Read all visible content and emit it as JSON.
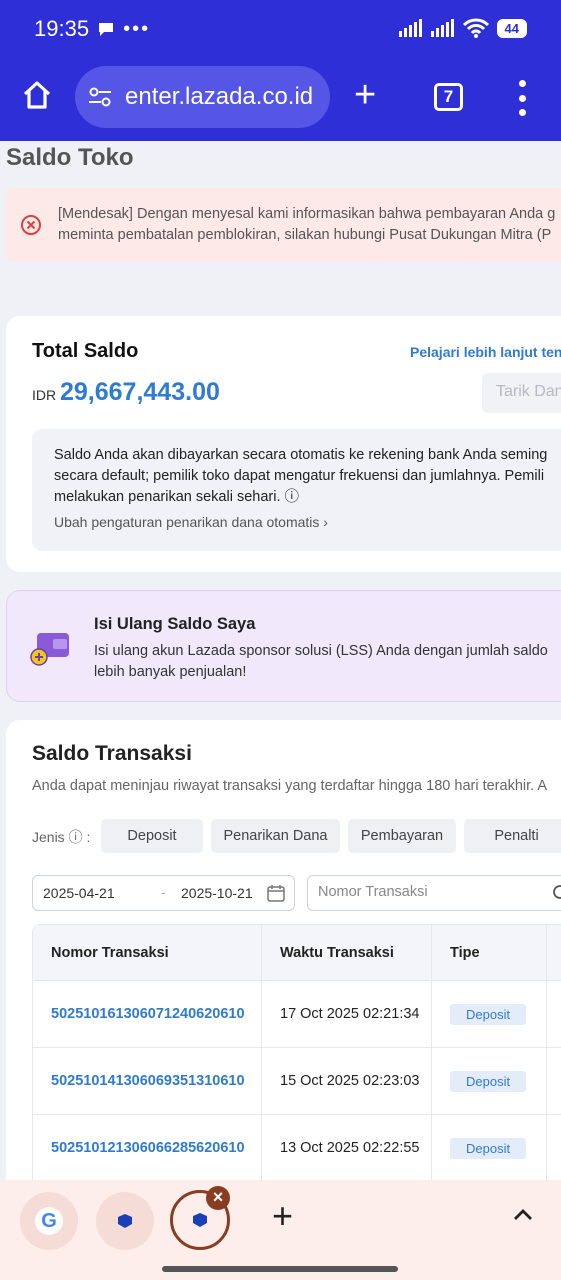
{
  "status_bar": {
    "time": "19:35",
    "extra": "•••",
    "battery": "44"
  },
  "browser": {
    "url": "enter.lazada.co.id",
    "tab_count": "7"
  },
  "page": {
    "title": "Saldo Toko"
  },
  "alert": {
    "line1": "[Mendesak] Dengan menyesal kami informasikan bahwa pembayaran Anda g",
    "line2": "meminta pembatalan pemblokiran, silakan hubungi Pusat Dukungan Mitra (P"
  },
  "total_saldo": {
    "heading": "Total Saldo",
    "learn_more": "Pelajari lebih lanjut ten",
    "currency": "IDR",
    "amount": "29,667,443.00",
    "withdraw_button": "Tarik Dan",
    "info_line1": "Saldo Anda akan dibayarkan secara otomatis ke rekening bank Anda seming",
    "info_line2": "secara default; pemilik toko dapat mengatur frekuensi dan jumlahnya. Pemili",
    "info_line3": "melakukan penarikan sekali sehari. ⓘ",
    "auto_withdraw_link": "Ubah pengaturan penarikan dana otomatis  ›"
  },
  "topup": {
    "heading": "Isi Ulang Saldo Saya",
    "line1": "Isi ulang akun Lazada sponsor solusi (LSS) Anda dengan jumlah saldo",
    "line2": "lebih banyak penjualan!"
  },
  "transactions": {
    "heading": "Saldo Transaksi",
    "subtitle": "Anda dapat meninjau riwayat transaksi yang terdaftar hingga 180 hari terakhir. A",
    "filter_label": "Jenis ⓘ :",
    "filters": [
      "Deposit",
      "Penarikan Dana",
      "Pembayaran",
      "Penalti"
    ],
    "date_from": "2025-04-21",
    "date_to": "2025-10-21",
    "date_dash": "-",
    "search_placeholder": "Nomor Transaksi",
    "columns": [
      "Nomor Transaksi",
      "Waktu Transaksi",
      "Tipe"
    ],
    "rows": [
      {
        "id": "502510161306071240620610",
        "time": "17 Oct 2025 02:21:34",
        "type": "Deposit"
      },
      {
        "id": "502510141306069351310610",
        "time": "15 Oct 2025 02:23:03",
        "type": "Deposit"
      },
      {
        "id": "502510121306066285620610",
        "time": "13 Oct 2025 02:22:55",
        "type": "Deposit"
      }
    ]
  },
  "bottom_bar": {
    "google_letter": "G",
    "new_tab": "+"
  }
}
